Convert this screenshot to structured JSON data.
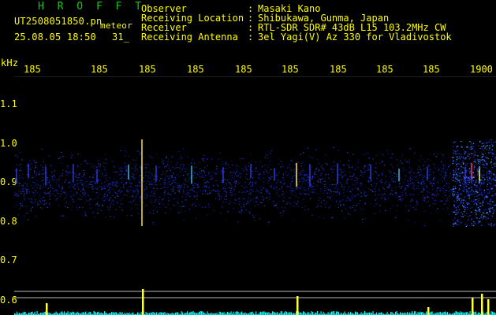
{
  "header": {
    "brand": "H R O F F T",
    "filename": "UT2508051850.pn",
    "meteor": "meteor",
    "datetime": "25.08.05 18:50",
    "fragment": "31_"
  },
  "info": [
    {
      "label": "Observer",
      "value": "Masaki Kano"
    },
    {
      "label": "Receiving Location",
      "value": "Shibukawa, Gunma, Japan"
    },
    {
      "label": "Receiver",
      "value": "RTL-SDR SDR# 43dB L15 103.2MHz CW"
    },
    {
      "label": "Receiving Antenna",
      "value": "3el Yagi(V) Az 330 for Vladivostok"
    }
  ],
  "axis": {
    "y_unit": "kHz",
    "y_ticks": [
      "1.1",
      "1.0",
      "0.9",
      "0.8",
      "0.7",
      "0.6"
    ],
    "x_ticks": [
      "185",
      "185",
      "185",
      "185",
      "185",
      "185",
      "185",
      "185",
      "185",
      "1900"
    ]
  },
  "colors": {
    "text": "#ffff00",
    "brand": "#18c618",
    "signal": "#00ffff"
  }
}
